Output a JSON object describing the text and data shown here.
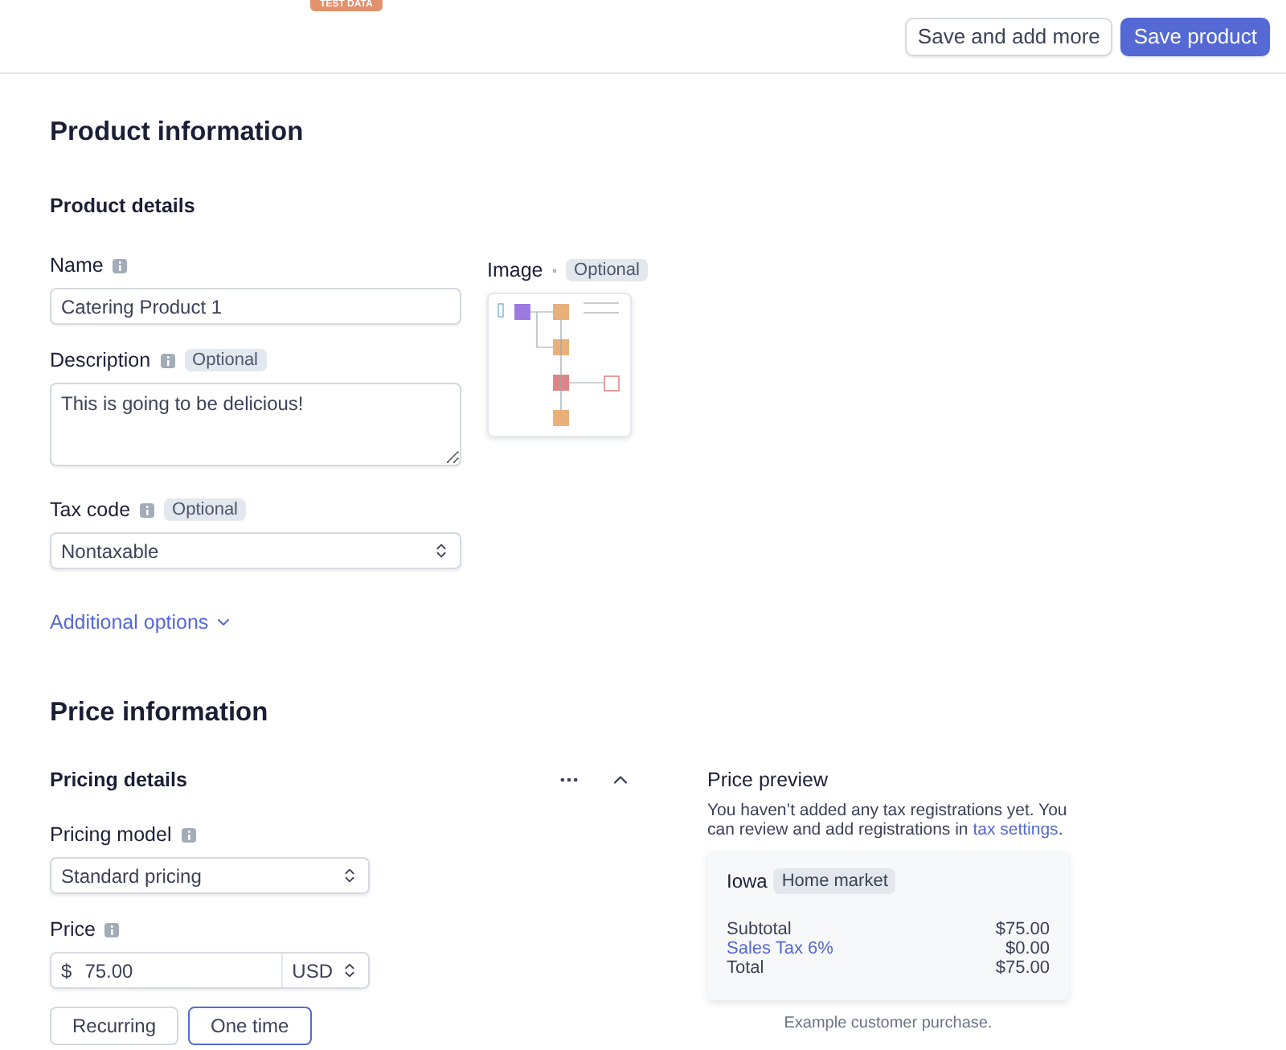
{
  "header": {
    "badge": "TEST DATA",
    "buttons": [
      {
        "label": "Save and add more",
        "kind": "secondary"
      },
      {
        "label": "Save product",
        "kind": "primary"
      }
    ]
  },
  "product_information": {
    "title": "Product information",
    "subtitle": "Product details",
    "fields": [
      {
        "kind": "input",
        "label": "Name",
        "value": "Catering Product 1"
      },
      {
        "kind": "textarea",
        "label": "Description",
        "badge": "Optional",
        "value": "This is going to be delicious!"
      },
      {
        "kind": "select",
        "label": "Tax code",
        "badge": "Optional",
        "value": "Nontaxable"
      }
    ],
    "image": {
      "label": "Image",
      "badge": "Optional"
    },
    "additional_options": "Additional options"
  },
  "price_information": {
    "title": "Price information",
    "details": {
      "title": "Pricing details",
      "pricing_model": {
        "label": "Pricing model",
        "value": "Standard pricing"
      },
      "price": {
        "label": "Price",
        "currency_symbol": "$",
        "amount": "75.00",
        "currency": "USD"
      },
      "types": [
        {
          "label": "Recurring",
          "selected": false
        },
        {
          "label": "One time",
          "selected": true
        }
      ]
    },
    "preview": {
      "title": "Price preview",
      "note": "You haven’t added any tax registrations yet. You can review and add registrations in",
      "link": "tax settings",
      "note_end": ".",
      "region": "Iowa",
      "tag": "Home market",
      "lines": [
        {
          "kind": "plain",
          "label": "Subtotal",
          "amount": "$75.00"
        },
        {
          "kind": "link",
          "label": "Sales Tax 6%",
          "amount": "$0.00"
        },
        {
          "kind": "plain",
          "label": "Total",
          "amount": "$75.00"
        }
      ],
      "caption": "Example customer purchase."
    }
  }
}
